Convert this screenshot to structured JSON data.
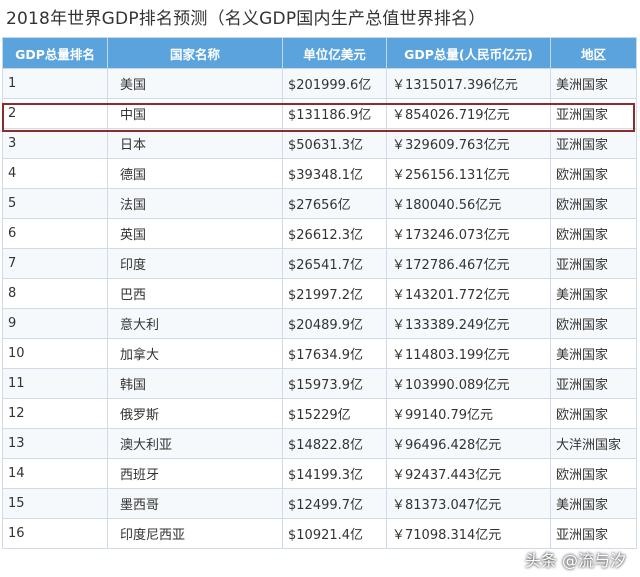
{
  "title": "2018年世界GDP排名预测（名义GDP国内生产总值世界排名）",
  "headers": [
    "GDP总量排名",
    "国家名称",
    "单位亿美元",
    "GDP总量(人民币亿元)",
    "地区"
  ],
  "rows": [
    [
      "1",
      "美国",
      "$201999.6亿",
      "￥1315017.396亿元",
      "美洲国家"
    ],
    [
      "2",
      "中国",
      "$131186.9亿",
      "￥854026.719亿元",
      "亚洲国家"
    ],
    [
      "3",
      "日本",
      "$50631.3亿",
      "￥329609.763亿元",
      "亚洲国家"
    ],
    [
      "4",
      "德国",
      "$39348.1亿",
      "￥256156.131亿元",
      "欧洲国家"
    ],
    [
      "5",
      "法国",
      "$27656亿",
      "￥180040.56亿元",
      "欧洲国家"
    ],
    [
      "6",
      "英国",
      "$26612.3亿",
      "￥173246.073亿元",
      "欧洲国家"
    ],
    [
      "7",
      "印度",
      "$26541.7亿",
      "￥172786.467亿元",
      "亚洲国家"
    ],
    [
      "8",
      "巴西",
      "$21997.2亿",
      "￥143201.772亿元",
      "美洲国家"
    ],
    [
      "9",
      "意大利",
      "$20489.9亿",
      "￥133389.249亿元",
      "欧洲国家"
    ],
    [
      "10",
      "加拿大",
      "$17634.9亿",
      "￥114803.199亿元",
      "美洲国家"
    ],
    [
      "11",
      "韩国",
      "$15973.9亿",
      "￥103990.089亿元",
      "亚洲国家"
    ],
    [
      "12",
      "俄罗斯",
      "$15229亿",
      "￥99140.79亿元",
      "欧洲国家"
    ],
    [
      "13",
      "澳大利亚",
      "$14822.8亿",
      "￥96496.428亿元",
      "大洋洲国家"
    ],
    [
      "14",
      "西班牙",
      "$14199.3亿",
      "￥92437.443亿元",
      "欧洲国家"
    ],
    [
      "15",
      "墨西哥",
      "$12499.7亿",
      "￥81373.047亿元",
      "美洲国家"
    ],
    [
      "16",
      "印度尼西亚",
      "$10921.4亿",
      "￥71098.314亿元",
      "亚洲国家"
    ]
  ],
  "watermark": "头条 @流与汐",
  "colors": {
    "header_bg": "#5ba3dc",
    "highlight_border": "#8b2b2b"
  }
}
